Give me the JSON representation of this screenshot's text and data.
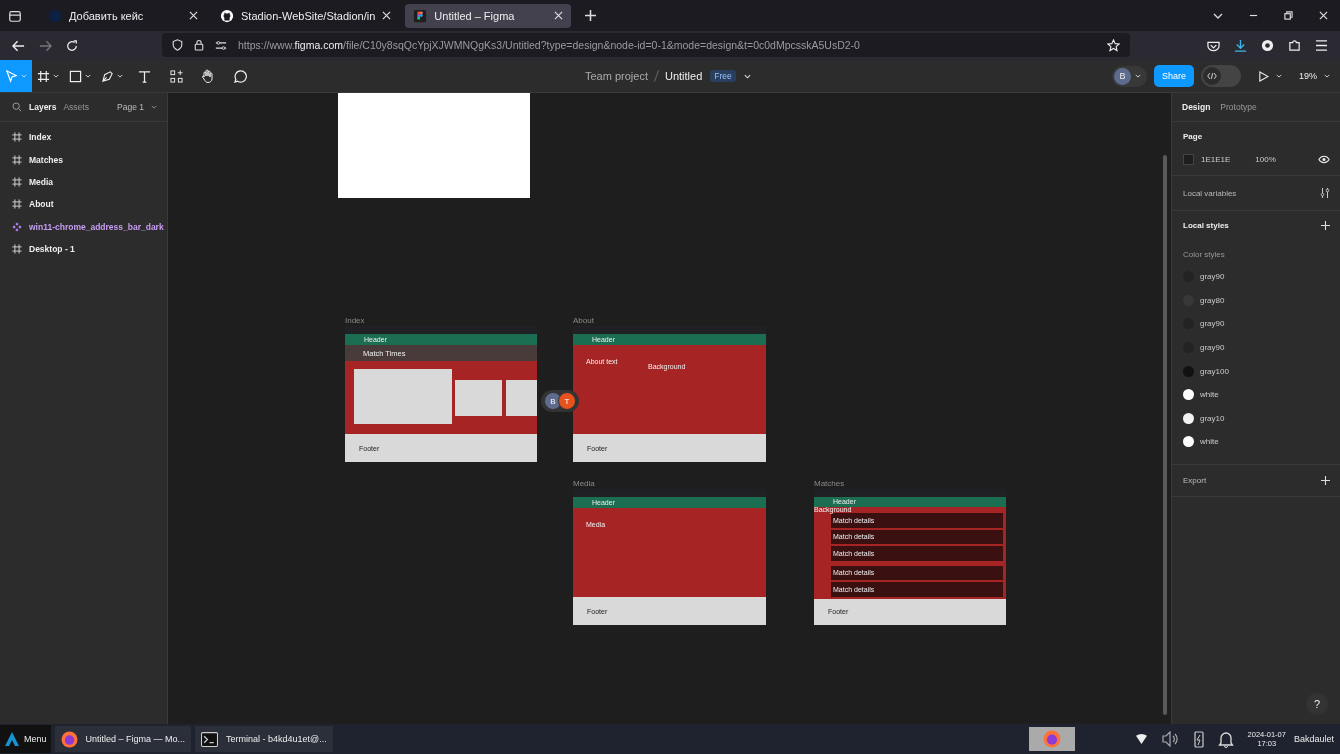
{
  "browser": {
    "tabs": [
      {
        "title": "Добавить кейс",
        "kind": "globe",
        "selected": false
      },
      {
        "title": "Stadion-WebSite/Stadion/in",
        "kind": "github",
        "selected": false
      },
      {
        "title": "Untitled – Figma",
        "kind": "figma",
        "selected": true
      }
    ],
    "url": {
      "prefix": "https://www.",
      "domain": "figma.com",
      "path": "/file/C10y8sqQcYpjXJWMNQgKs3/Untitled?type=design&node-id=0-1&mode=design&t=0c0dMpcsskA5UsD2-0"
    }
  },
  "toolbar": {
    "tools": [
      {
        "kind": "move",
        "selected": true
      },
      {
        "kind": "frame",
        "selected": false
      },
      {
        "kind": "shape",
        "selected": false
      },
      {
        "kind": "pen",
        "selected": false
      },
      {
        "kind": "text",
        "selected": false
      },
      {
        "kind": "resources",
        "selected": false
      },
      {
        "kind": "hand",
        "selected": false
      },
      {
        "kind": "comment",
        "selected": false
      }
    ],
    "dev_mode": false,
    "project": "Team project",
    "file": "Untitled",
    "plan": "Free",
    "avatar": "B",
    "share": "Share",
    "zoom": "19%"
  },
  "layers_panel": {
    "tabs": [
      {
        "label": "Layers",
        "selected": true
      },
      {
        "label": "Assets",
        "selected": false
      }
    ],
    "page": "Page 1",
    "layers": [
      {
        "name": "Index",
        "kind": "frame"
      },
      {
        "name": "Matches",
        "kind": "frame"
      },
      {
        "name": "Media",
        "kind": "frame"
      },
      {
        "name": "About",
        "kind": "frame"
      },
      {
        "name": "win11-chrome_address_bar_dark",
        "kind": "component"
      },
      {
        "name": "Desktop - 1",
        "kind": "frame"
      }
    ]
  },
  "canvas": {
    "frames": [
      {
        "kind": "blank"
      },
      {
        "kind": "index",
        "label": "Index",
        "header": "Header",
        "banner": "Match Times",
        "footer": "Footer"
      },
      {
        "kind": "about",
        "label": "About",
        "header": "Header",
        "texts": [
          "About text",
          "Background"
        ],
        "footer": "Footer"
      },
      {
        "kind": "media",
        "label": "Media",
        "header": "Header",
        "texts": [
          "Media"
        ],
        "footer": "Footer"
      },
      {
        "kind": "matches",
        "label": "Matches",
        "header": "Header",
        "background": "Background",
        "items": [
          "Match details",
          "Match details",
          "Match details",
          "Match details",
          "Match details"
        ],
        "footer": "Footer"
      }
    ],
    "collaborators": [
      {
        "initial": "B",
        "color": "#5d6b8e"
      },
      {
        "initial": "T",
        "color": "#e8521f"
      }
    ],
    "help": "?"
  },
  "design_panel": {
    "tabs": [
      {
        "label": "Design",
        "selected": true
      },
      {
        "label": "Prototype",
        "selected": false
      }
    ],
    "page_title": "Page",
    "page_color": "1E1E1E",
    "page_opacity": "100%",
    "local_variables": "Local variables",
    "local_styles": "Local styles",
    "color_styles_title": "Color styles",
    "color_styles": [
      {
        "name": "gray90",
        "color": "#232323"
      },
      {
        "name": "gray80",
        "color": "#383838"
      },
      {
        "name": "gray90",
        "color": "#232323"
      },
      {
        "name": "gray90",
        "color": "#232323"
      },
      {
        "name": "gray100",
        "color": "#111111"
      },
      {
        "name": "white",
        "color": "#ffffff"
      },
      {
        "name": "gray10",
        "color": "#f2f2f2"
      },
      {
        "name": "white",
        "color": "#ffffff"
      }
    ],
    "export": "Export"
  },
  "taskbar": {
    "menu": "Menu",
    "apps": [
      {
        "title": "Untitled – Figma — Mo...",
        "kind": "browser"
      },
      {
        "title": "Terminal - b4kd4u1et@...",
        "kind": "terminal"
      }
    ],
    "date": "2024-01-07",
    "time": "17:03",
    "user": "Bakdaulet"
  }
}
